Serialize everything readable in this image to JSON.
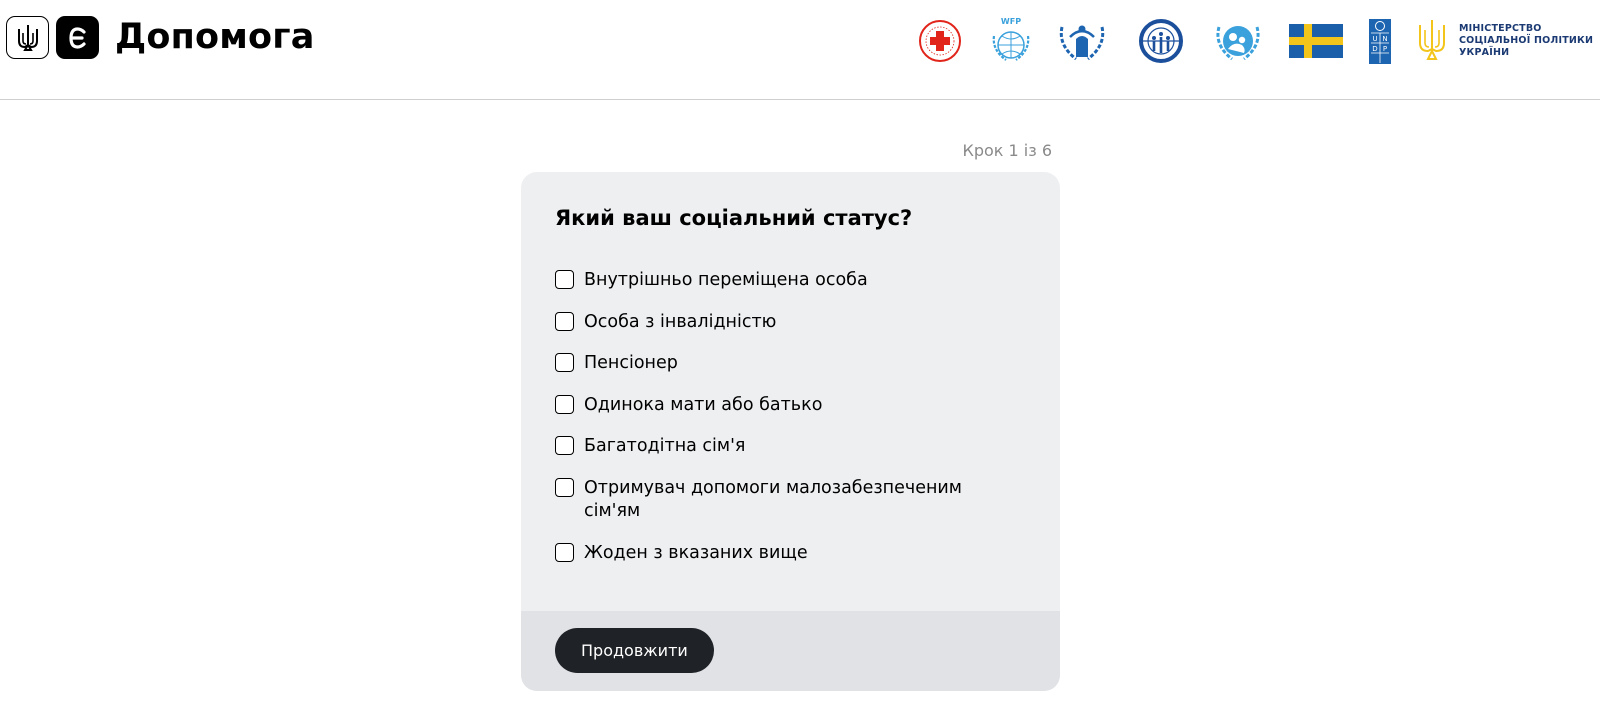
{
  "header": {
    "brand_title": "Допомога",
    "e_logo_letter": "Є",
    "ministry_text_line1": "МІНІСТЕРСТВО",
    "ministry_text_line2": "СОЦІАЛЬНОЇ ПОЛІТИКИ",
    "ministry_text_line3": "УКРАЇНИ",
    "wfp_text": "WFP",
    "undp_letters": [
      "U",
      "N",
      "D",
      "P"
    ],
    "partner_logos": [
      "red-cross-logo",
      "wfp-logo",
      "unhcr-logo",
      "iom-logo",
      "unicef-logo",
      "sweden-flag-logo",
      "undp-logo",
      "ministry-logo"
    ]
  },
  "form": {
    "step_label": "Крок 1 із 6",
    "question": "Який ваш соціальний статус?",
    "options": [
      {
        "label": "Внутрішньо переміщена особа",
        "checked": false
      },
      {
        "label": "Особа з інвалідністю",
        "checked": false
      },
      {
        "label": "Пенсіонер",
        "checked": false
      },
      {
        "label": "Одинока мати або батько",
        "checked": false
      },
      {
        "label": "Багатодітна сім'я",
        "checked": false
      },
      {
        "label": "Отримувач допомоги малозабезпеченим сім'ям",
        "checked": false
      },
      {
        "label": "Жоден з вказаних вище",
        "checked": false
      }
    ],
    "continue_label": "Продовжити"
  },
  "colors": {
    "card_bg": "#eeeff1",
    "footer_bg": "#e0e2e6",
    "button_bg": "#1f2226",
    "sweden_blue": "#1b5fab",
    "sweden_yellow": "#f3c51a",
    "un_blue": "#3aa1dc",
    "undp_blue": "#1d64b1",
    "red_cross": "#e1251b"
  }
}
